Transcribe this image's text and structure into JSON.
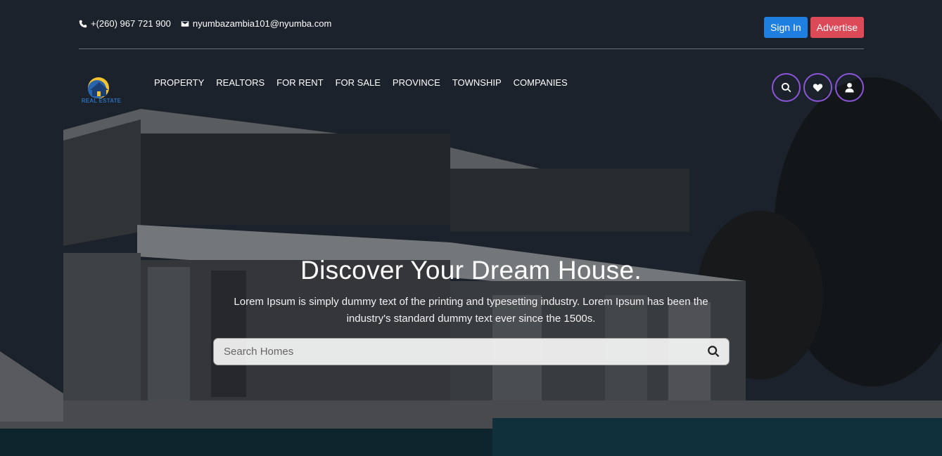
{
  "topbar": {
    "phone": "+(260) 967 721 900",
    "email": "nyumbazambia101@nyumba.com",
    "signin_label": "Sign In",
    "advertise_label": "Advertise"
  },
  "logo": {
    "text": "REAL ESTATE"
  },
  "nav": {
    "items": [
      {
        "label": "PROPERTY"
      },
      {
        "label": "REALTORS"
      },
      {
        "label": "FOR RENT"
      },
      {
        "label": "FOR SALE"
      },
      {
        "label": "PROVINCE"
      },
      {
        "label": "TOWNSHIP"
      },
      {
        "label": "COMPANIES"
      }
    ],
    "actions": [
      "search-icon",
      "heart-icon",
      "user-icon"
    ]
  },
  "hero": {
    "title": "Discover Your Dream House.",
    "subtitle": "Lorem Ipsum is simply dummy text of the printing and typesetting industry. Lorem Ipsum has been the industry's standard dummy text ever since the 1500s.",
    "search_placeholder": "Search Homes"
  },
  "colors": {
    "signin": "#1f7fe0",
    "advertise": "#dc4a57",
    "circle_border": "#8a55d8"
  }
}
